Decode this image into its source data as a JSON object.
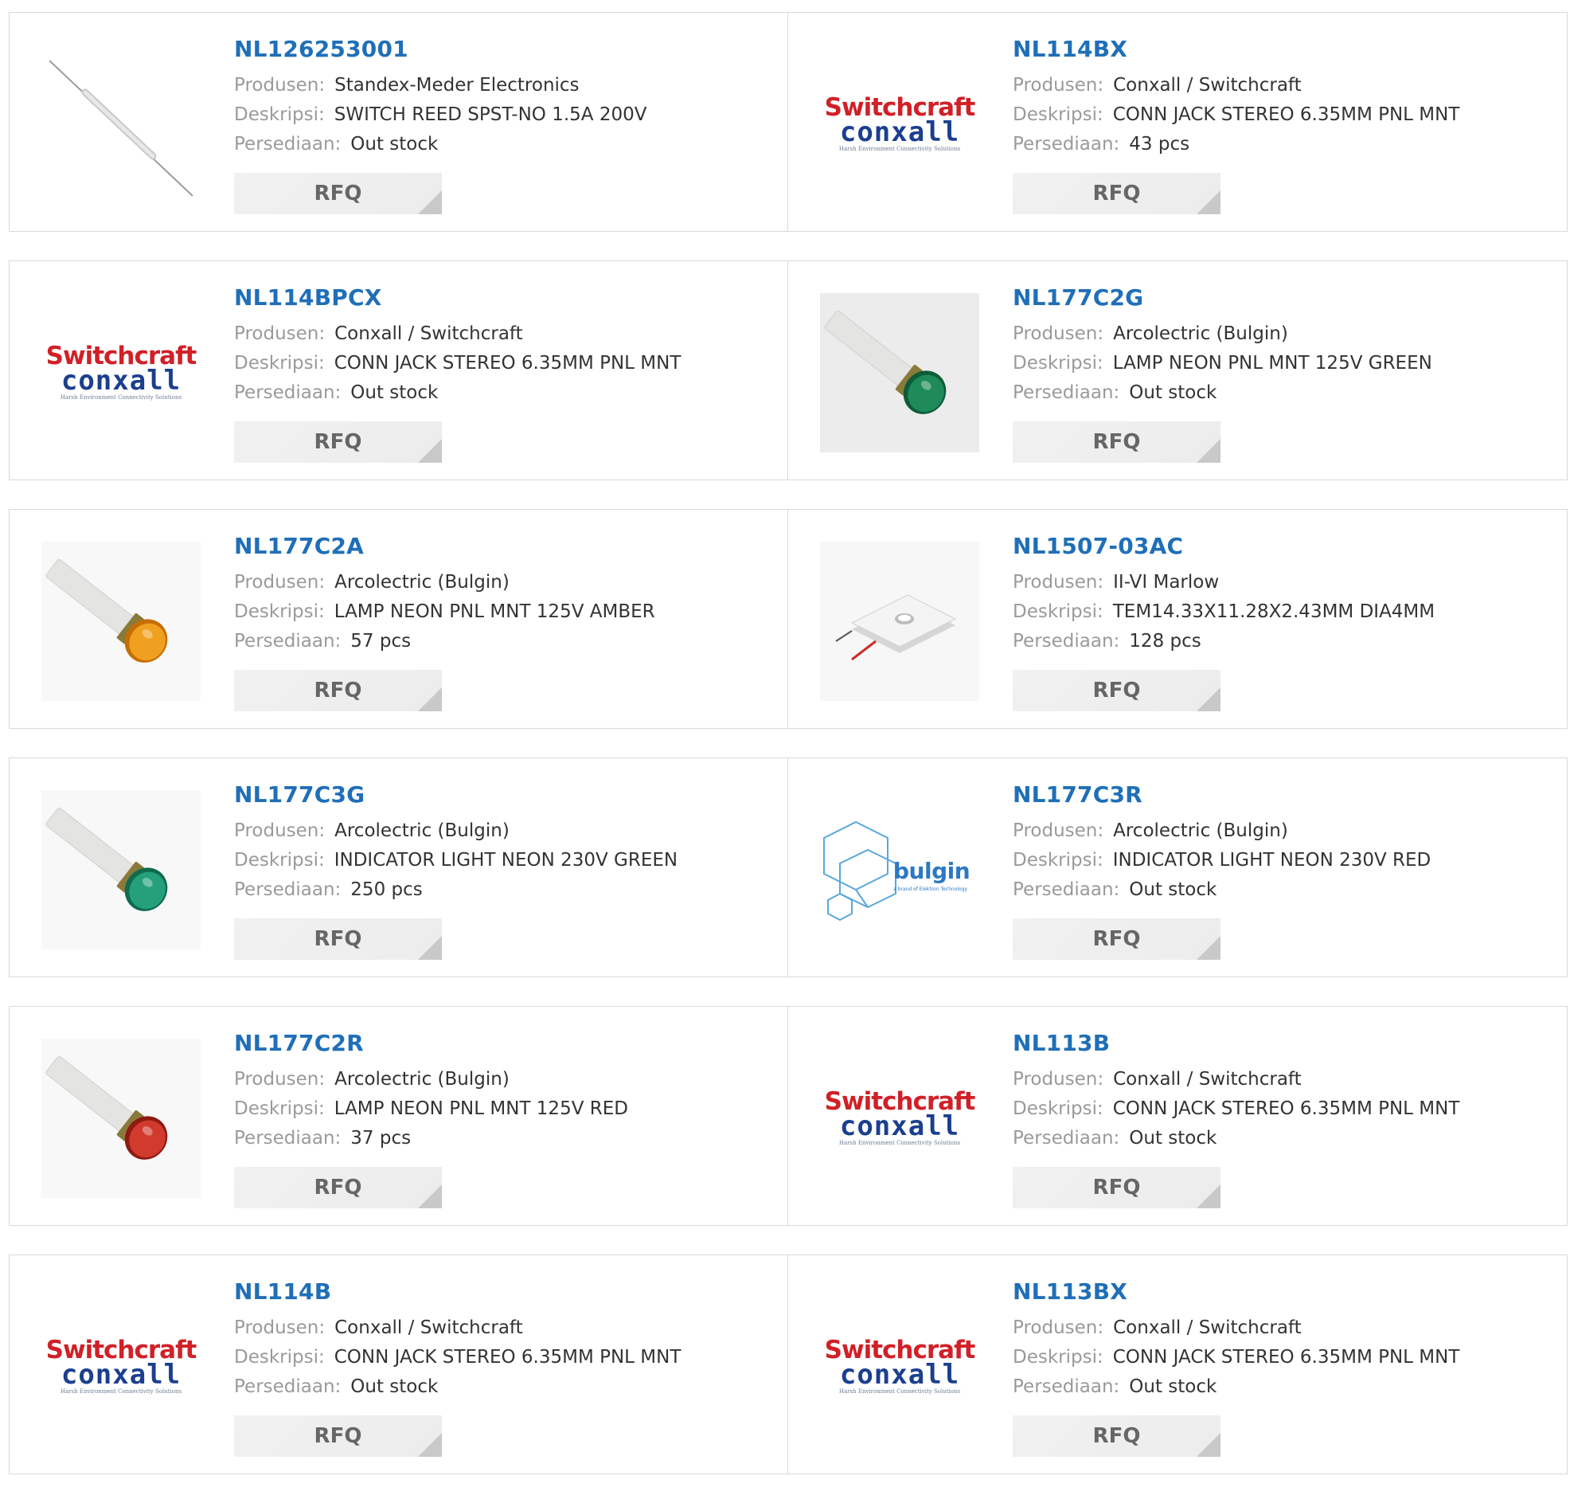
{
  "labels": {
    "manufacturer": "Produsen:",
    "description": "Deskripsi:",
    "stock": "Persediaan:",
    "rfq": "RFQ"
  },
  "logo_text": {
    "switchcraft_top": "Switchcraft",
    "switchcraft_mid": "conxall",
    "switchcraft_tagline": "Harsh Environment Connectivity Solutions",
    "bulgin_name": "bulgin",
    "bulgin_tagline": "a brand of Elektron Technology"
  },
  "products": [
    {
      "part": "NL126253001",
      "manufacturer": "Standex-Meder Electronics",
      "description": "SWITCH REED SPST-NO 1.5A 200V",
      "stock": "Out stock",
      "image": "reed-switch"
    },
    {
      "part": "NL114BX",
      "manufacturer": "Conxall / Switchcraft",
      "description": "CONN JACK STEREO 6.35MM PNL MNT",
      "stock": "43 pcs",
      "image": "switchcraft-logo"
    },
    {
      "part": "NL114BPCX",
      "manufacturer": "Conxall / Switchcraft",
      "description": "CONN JACK STEREO 6.35MM PNL MNT",
      "stock": "Out stock",
      "image": "switchcraft-logo"
    },
    {
      "part": "NL177C2G",
      "manufacturer": "Arcolectric (Bulgin)",
      "description": "LAMP NEON PNL MNT 125V GREEN",
      "stock": "Out stock",
      "image": "lamp-green-large"
    },
    {
      "part": "NL177C2A",
      "manufacturer": "Arcolectric (Bulgin)",
      "description": "LAMP NEON PNL MNT 125V AMBER",
      "stock": "57 pcs",
      "image": "lamp-amber"
    },
    {
      "part": "NL1507-03AC",
      "manufacturer": "II-VI Marlow",
      "description": "TEM14.33X11.28X2.43MM DIA4MM",
      "stock": "128 pcs",
      "image": "thermoelectric-module"
    },
    {
      "part": "NL177C3G",
      "manufacturer": "Arcolectric (Bulgin)",
      "description": "INDICATOR LIGHT NEON 230V GREEN",
      "stock": "250 pcs",
      "image": "lamp-green-small"
    },
    {
      "part": "NL177C3R",
      "manufacturer": "Arcolectric (Bulgin)",
      "description": "INDICATOR LIGHT NEON 230V RED",
      "stock": "Out stock",
      "image": "bulgin-logo"
    },
    {
      "part": "NL177C2R",
      "manufacturer": "Arcolectric (Bulgin)",
      "description": "LAMP NEON PNL MNT 125V RED",
      "stock": "37 pcs",
      "image": "lamp-red"
    },
    {
      "part": "NL113B",
      "manufacturer": "Conxall / Switchcraft",
      "description": "CONN JACK STEREO 6.35MM PNL MNT",
      "stock": "Out stock",
      "image": "switchcraft-logo"
    },
    {
      "part": "NL114B",
      "manufacturer": "Conxall / Switchcraft",
      "description": "CONN JACK STEREO 6.35MM PNL MNT",
      "stock": "Out stock",
      "image": "switchcraft-logo"
    },
    {
      "part": "NL113BX",
      "manufacturer": "Conxall / Switchcraft",
      "description": "CONN JACK STEREO 6.35MM PNL MNT",
      "stock": "Out stock",
      "image": "switchcraft-logo"
    }
  ],
  "colors": {
    "part_link": "#1f6fb8",
    "label": "#9a9a9a",
    "value": "#333333",
    "rfq_bg": "#eeeeee",
    "border": "#d9d9d9"
  }
}
